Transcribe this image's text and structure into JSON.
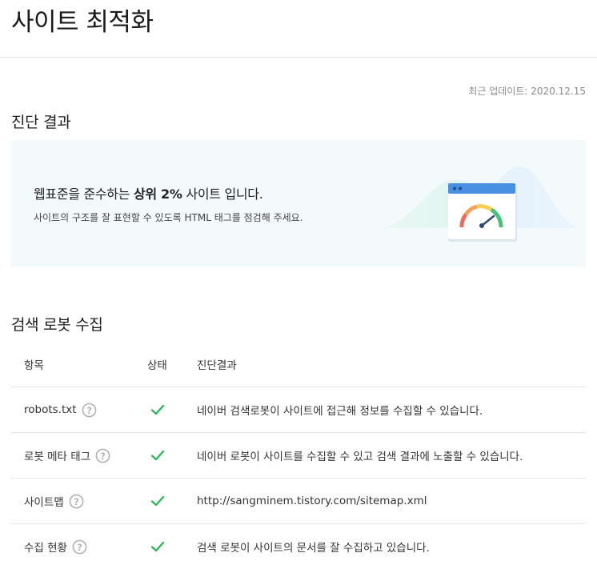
{
  "page": {
    "title": "사이트 최적화",
    "last_updated": "최근 업데이트: 2020.12.15"
  },
  "diagnosis": {
    "title": "진단 결과",
    "headline_prefix": "웹표준을 준수하는 ",
    "headline_strong": "상위 2%",
    "headline_suffix": " 사이트 입니다.",
    "subtext": "사이트의 구조를 잘 표현할 수 있도록 HTML 태그를 점검해 주세요.",
    "gauge_level_percent": 70
  },
  "robot": {
    "title": "검색 로봇 수집",
    "headers": {
      "item": "항목",
      "status": "상태",
      "result": "진단결과"
    },
    "rows": [
      {
        "item": "robots.txt",
        "result": "네이버 검색로봇이 사이트에 접근해 정보를 수집할 수 있습니다."
      },
      {
        "item": "로봇 메타 태그",
        "result": "네이버 로봇이 사이트를 수집할 수 있고 검색 결과에 노출할 수 있습니다."
      },
      {
        "item": "사이트맵",
        "result": "http://sangminem.tistory.com/sitemap.xml"
      },
      {
        "item": "수집 현황",
        "result": "검색 로봇이 사이트의 문서를 잘 수집하고 있습니다."
      }
    ]
  },
  "colors": {
    "check": "#2fb85a",
    "help": "#b5b5b5",
    "card_bg": "#f4f9fc",
    "browser_bar": "#4a90e2"
  },
  "icons": {
    "help": "question-circle-icon",
    "check": "check-icon",
    "gauge": "speedometer-icon"
  }
}
